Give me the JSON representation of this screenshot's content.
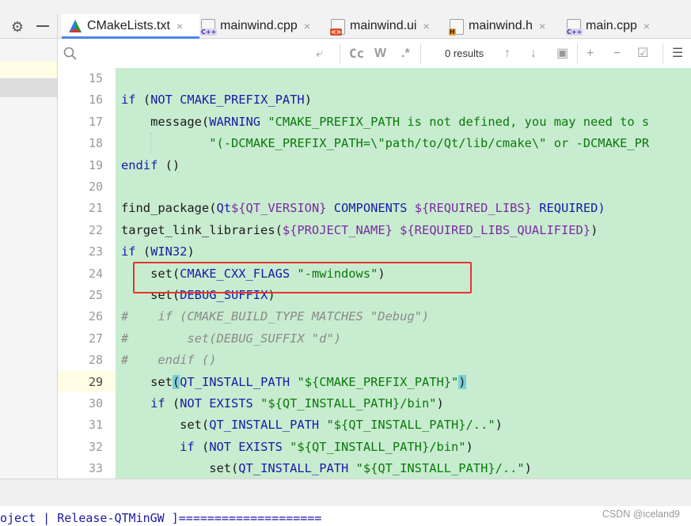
{
  "tabs": [
    {
      "label": "CMakeLists.txt",
      "icon": "cmake-triangle-icon",
      "active": true
    },
    {
      "label": "mainwind.cpp",
      "icon": "cpp-file-icon",
      "badge": "C++"
    },
    {
      "label": "mainwind.ui",
      "icon": "ui-file-icon",
      "badge": "<>"
    },
    {
      "label": "mainwind.h",
      "icon": "header-file-icon",
      "badge": "H"
    },
    {
      "label": "main.cpp",
      "icon": "cpp-file-icon",
      "badge": "C++"
    }
  ],
  "tab_close_glyph": "×",
  "search": {
    "placeholder": "",
    "results": "0 results",
    "case_label": "Cc",
    "word_label": "W",
    "regex_label": ".*"
  },
  "gutter": {
    "line_numbers": [
      "15",
      "16",
      "17",
      "18",
      "19",
      "20",
      "21",
      "22",
      "23",
      "24",
      "25",
      "26",
      "27",
      "28",
      "29",
      "30",
      "31",
      "32",
      "33"
    ],
    "current_line": "29"
  },
  "code": {
    "l15": "",
    "l16a": "if",
    "l16b": " (",
    "l16c": "NOT CMAKE_PREFIX_PATH",
    "l16d": ")",
    "l17a": "    message(",
    "l17b": "WARNING",
    "l17c": " ",
    "l17d": "\"CMAKE_PREFIX_PATH is not defined, you may need to s",
    "l18a": "            ",
    "l18b": "\"(-DCMAKE_PREFIX_PATH=\\\"path/to/Qt/lib/cmake\\\" or -DCMAKE_PR",
    "l19a": "endif",
    "l19b": " ()",
    "l20": "",
    "l21a": "find_package(",
    "l21b": "Qt",
    "l21c": "${QT_VERSION}",
    "l21d": " COMPONENTS ",
    "l21e": "${REQUIRED_LIBS}",
    "l21f": " REQUIRED)",
    "l22a": "target_link_libraries(",
    "l22b": "${PROJECT_NAME}",
    "l22c": " ",
    "l22d": "${REQUIRED_LIBS_QUALIFIED}",
    "l22e": ")",
    "l23a": "if",
    "l23b": " (",
    "l23c": "WIN32",
    "l23d": ")",
    "l24a": "    set(",
    "l24b": "CMAKE_CXX_FLAGS",
    "l24c": " ",
    "l24d": "\"-mwindows\"",
    "l24e": ")",
    "l25a": "    set(",
    "l25b": "DEBUG_SUFFIX",
    "l25c": ")",
    "l26": "#    if (CMAKE_BUILD_TYPE MATCHES \"Debug\")",
    "l27": "#        set(DEBUG_SUFFIX \"d\")",
    "l28": "#    endif ()",
    "l29a": "    set",
    "l29b": "(",
    "l29c": "QT_INSTALL_PATH",
    "l29d": " ",
    "l29e": "\"${CMAKE_PREFIX_PATH}\"",
    "l29f": ")",
    "l30a": "    if",
    "l30b": " (",
    "l30c": "NOT EXISTS ",
    "l30d": "\"${QT_INSTALL_PATH}/bin\"",
    "l30e": ")",
    "l31a": "        set(",
    "l31b": "QT_INSTALL_PATH",
    "l31c": " ",
    "l31d": "\"${QT_INSTALL_PATH}/..\"",
    "l31e": ")",
    "l32a": "        if",
    "l32b": " (",
    "l32c": "NOT EXISTS ",
    "l32d": "\"${QT_INSTALL_PATH}/bin\"",
    "l32e": ")",
    "l33a": "            set(",
    "l33b": "QT_INSTALL_PATH",
    "l33c": " ",
    "l33d": "\"${QT_INSTALL_PATH}/..\"",
    "l33e": ")"
  },
  "console_line": "oject | Release-QTMinGW ]====================",
  "watermark": "CSDN @iceland9",
  "colors": {
    "code_bg": "#c8ecd0",
    "highlight_box": "#e5352b",
    "active_tab_underline": "#4a86e8"
  }
}
